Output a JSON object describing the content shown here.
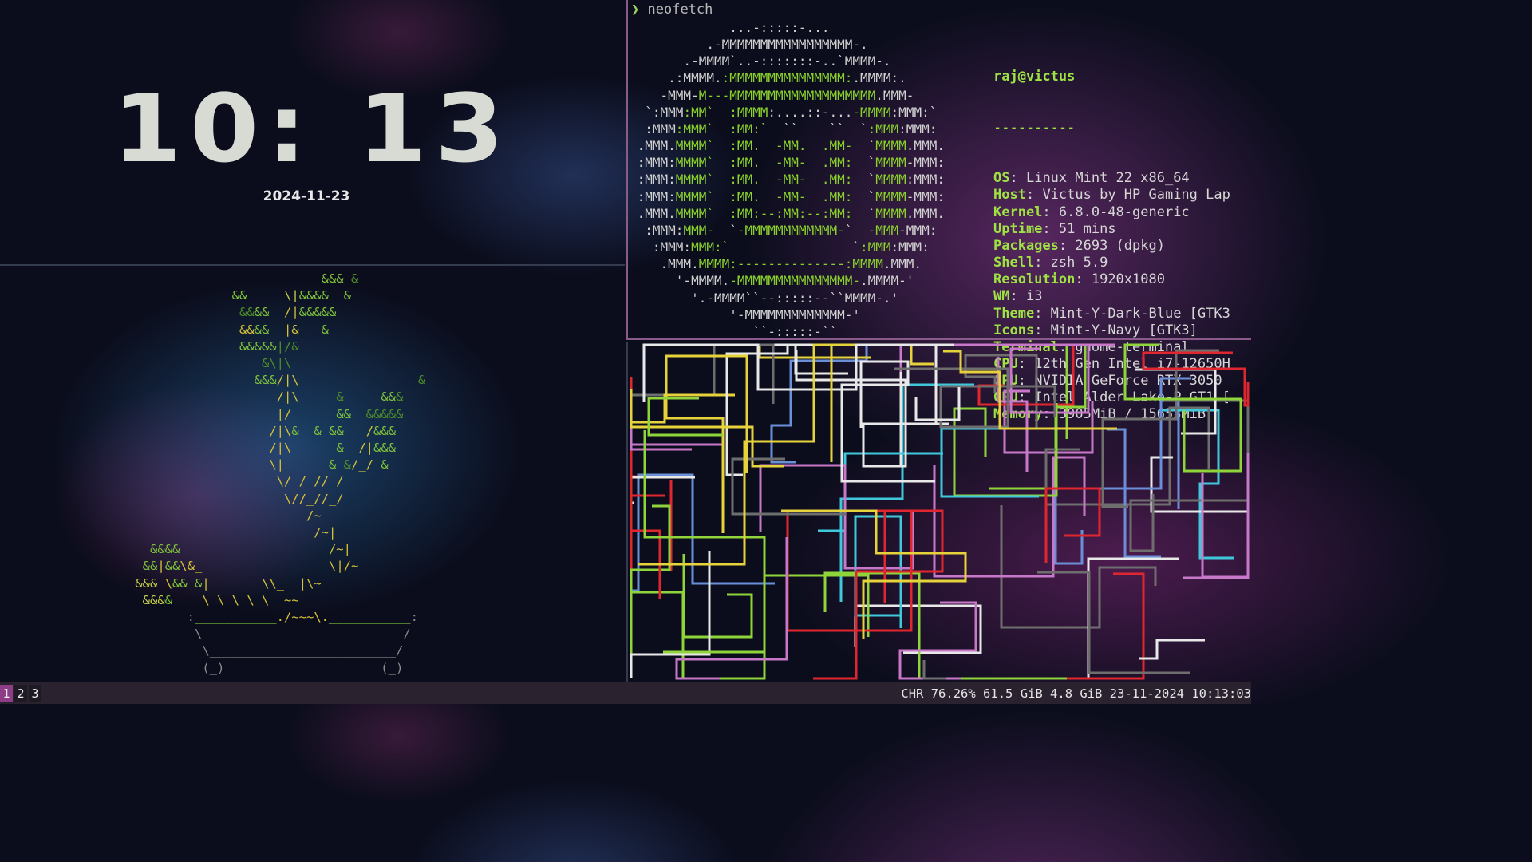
{
  "clock": {
    "time": "10: 13",
    "date": "2024-11-23"
  },
  "terminal": {
    "prompt_symbol": "❯",
    "command": "neofetch",
    "user_host": "raj@victus",
    "separator": "----------",
    "info": [
      {
        "key": "OS",
        "value": "Linux Mint 22 x86_64"
      },
      {
        "key": "Host",
        "value": "Victus by HP Gaming Lap"
      },
      {
        "key": "Kernel",
        "value": "6.8.0-48-generic"
      },
      {
        "key": "Uptime",
        "value": "51 mins"
      },
      {
        "key": "Packages",
        "value": "2693 (dpkg)"
      },
      {
        "key": "Shell",
        "value": "zsh 5.9"
      },
      {
        "key": "Resolution",
        "value": "1920x1080"
      },
      {
        "key": "WM",
        "value": "i3"
      },
      {
        "key": "Theme",
        "value": "Mint-Y-Dark-Blue [GTK3"
      },
      {
        "key": "Icons",
        "value": "Mint-Y-Navy [GTK3]"
      },
      {
        "key": "Terminal",
        "value": "gnome-terminal"
      },
      {
        "key": "CPU",
        "value": "12th Gen Intel i7-12650H"
      },
      {
        "key": "GPU",
        "value": "NVIDIA GeForce RTX 3050"
      },
      {
        "key": "GPU",
        "value": "Intel Alder Lake-P GT1 ["
      },
      {
        "key": "Memory",
        "value": "3905MiB / 15653MiB"
      }
    ]
  },
  "statusbar": {
    "workspaces": [
      "1",
      "2",
      "3"
    ],
    "active_workspace": "1",
    "status_text": "CHR 76.26% 61.5 GiB 4.8 GiB 23-11-2024 10:13:03"
  },
  "colors": {
    "accent": "#8e3c88",
    "neofetch_green": "#9fe244",
    "bar_bg": "#2b2230",
    "pipe_colors": [
      "#e8e8e8",
      "#e6d23a",
      "#8fd43a",
      "#3fc8dc",
      "#e0262e",
      "#6a8fd8",
      "#c878c8",
      "#6e6e6e"
    ]
  }
}
